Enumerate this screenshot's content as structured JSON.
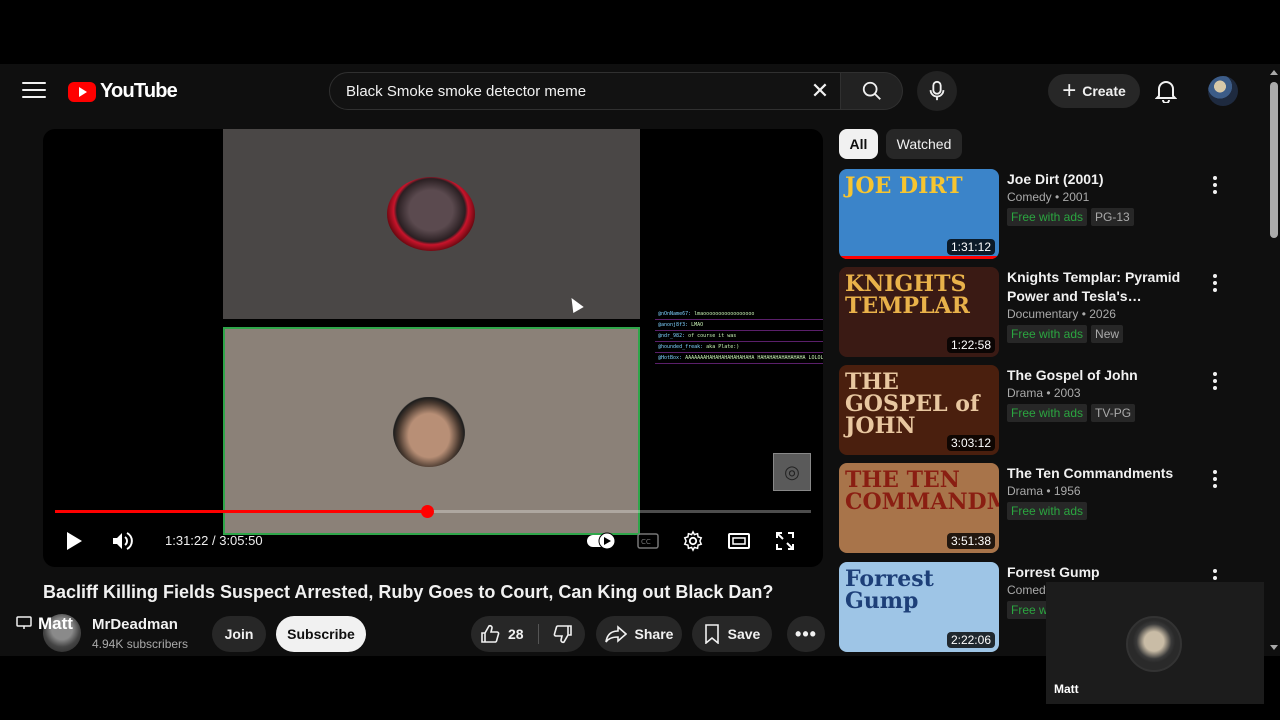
{
  "header": {
    "logo_text": "YouTube",
    "search_value": "Black Smoke smoke detector meme",
    "create_label": "Create"
  },
  "player": {
    "time": "1:31:22 / 3:05:50",
    "progress_fraction": 0.492,
    "chat_lines": [
      {
        "user": "@nOnName67:",
        "msg": "lmaooooooooooooooooo"
      },
      {
        "user": "@anonj8f3:",
        "msg": "LMAO"
      },
      {
        "user": "@ndr_982:",
        "msg": "of course it was"
      },
      {
        "user": "@hounded_freak:",
        "msg": "aka Plate:)"
      },
      {
        "user": "@HotBox:",
        "msg": "AAAAAAAHAHAHAHAHAHAHAHA HAHAHAHAHAHAHAHA LOLOLOLOLOL"
      }
    ]
  },
  "video": {
    "title": "Bacliff Killing Fields Suspect Arrested, Ruby Goes to Court, Can King out Black Dan?",
    "channel_name": "MrDeadman",
    "subscribers": "4.94K subscribers",
    "join_label": "Join",
    "subscribe_label": "Subscribe",
    "like_count": "28",
    "share_label": "Share",
    "save_label": "Save"
  },
  "pip_overlay": {
    "name": "Matt"
  },
  "filters": {
    "all": "All",
    "watched": "Watched"
  },
  "recommendations": [
    {
      "title": "Joe Dirt (2001)",
      "meta": "Comedy • 2001",
      "free": "Free with ads",
      "rating": "PG-13",
      "duration": "1:31:12",
      "thumb_text": "JOE DIRT",
      "thumb_bg": "#3b84c9",
      "thumb_color": "#f7c530",
      "watched": true
    },
    {
      "title": "Knights Templar: Pyramid Power and Tesla's Forbidden ...",
      "meta": "Documentary • 2026",
      "free": "Free with ads",
      "rating": "New",
      "duration": "1:22:58",
      "thumb_text": "KNIGHTS TEMPLAR",
      "thumb_bg": "#3a1a14",
      "thumb_color": "#e9b24a",
      "watched": false
    },
    {
      "title": "The Gospel of John",
      "meta": "Drama • 2003",
      "free": "Free with ads",
      "rating": "TV-PG",
      "duration": "3:03:12",
      "thumb_text": "THE GOSPEL of JOHN",
      "thumb_bg": "#4a1f0e",
      "thumb_color": "#e8c7a0",
      "watched": false
    },
    {
      "title": "The Ten Commandments",
      "meta": "Drama • 1956",
      "free": "Free with ads",
      "rating": "",
      "duration": "3:51:38",
      "thumb_text": "THE TEN COMMANDMENTS",
      "thumb_bg": "#a8744a",
      "thumb_color": "#8a1e12",
      "watched": false
    },
    {
      "title": "Forrest Gump",
      "meta": "Comedy",
      "free": "Free with ads",
      "rating": "",
      "duration": "2:22:06",
      "thumb_text": "Forrest Gump",
      "thumb_bg": "#9ec5e6",
      "thumb_color": "#1d3f78",
      "watched": false
    }
  ],
  "mini_card": {
    "name": "Matt"
  }
}
